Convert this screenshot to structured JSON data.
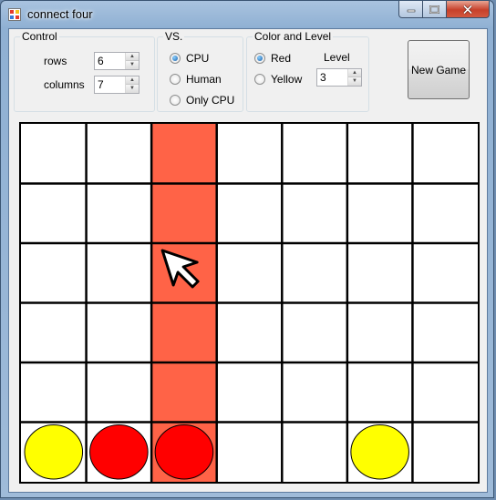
{
  "window": {
    "title": "connect four",
    "icons": {
      "app": "app-icon",
      "minimize": "minimize-icon",
      "maximize": "maximize-icon",
      "close": "close-icon"
    }
  },
  "control": {
    "title": "Control",
    "rows_label": "rows",
    "rows_value": "6",
    "columns_label": "columns",
    "columns_value": "7"
  },
  "vs": {
    "title": "VS.",
    "options": [
      {
        "label": "CPU",
        "selected": true
      },
      {
        "label": "Human",
        "selected": false
      },
      {
        "label": "Only CPU",
        "selected": false
      }
    ]
  },
  "color_level": {
    "title": "Color and Level",
    "colors": [
      {
        "label": "Red",
        "selected": true
      },
      {
        "label": "Yellow",
        "selected": false
      }
    ],
    "level_label": "Level",
    "level_value": "3"
  },
  "new_game_label": "New Game",
  "board": {
    "rows": 6,
    "columns": 7,
    "highlighted_column": 3,
    "highlight_color": "#ff6347",
    "grid_color": "#000000",
    "cell_color": "#ffffff",
    "piece_colors": {
      "red": "#ff0000",
      "yellow": "#ffff00"
    },
    "cells": [
      [
        "",
        "",
        "",
        "",
        "",
        "",
        ""
      ],
      [
        "",
        "",
        "",
        "",
        "",
        "",
        ""
      ],
      [
        "",
        "",
        "",
        "",
        "",
        "",
        ""
      ],
      [
        "",
        "",
        "",
        "",
        "",
        "",
        ""
      ],
      [
        "",
        "",
        "",
        "",
        "",
        "",
        ""
      ],
      [
        "yellow",
        "red",
        "red",
        "",
        "",
        "yellow",
        ""
      ]
    ]
  },
  "cursor": {
    "icon": "mouse-pointer-icon",
    "column": 3,
    "row": 3
  }
}
